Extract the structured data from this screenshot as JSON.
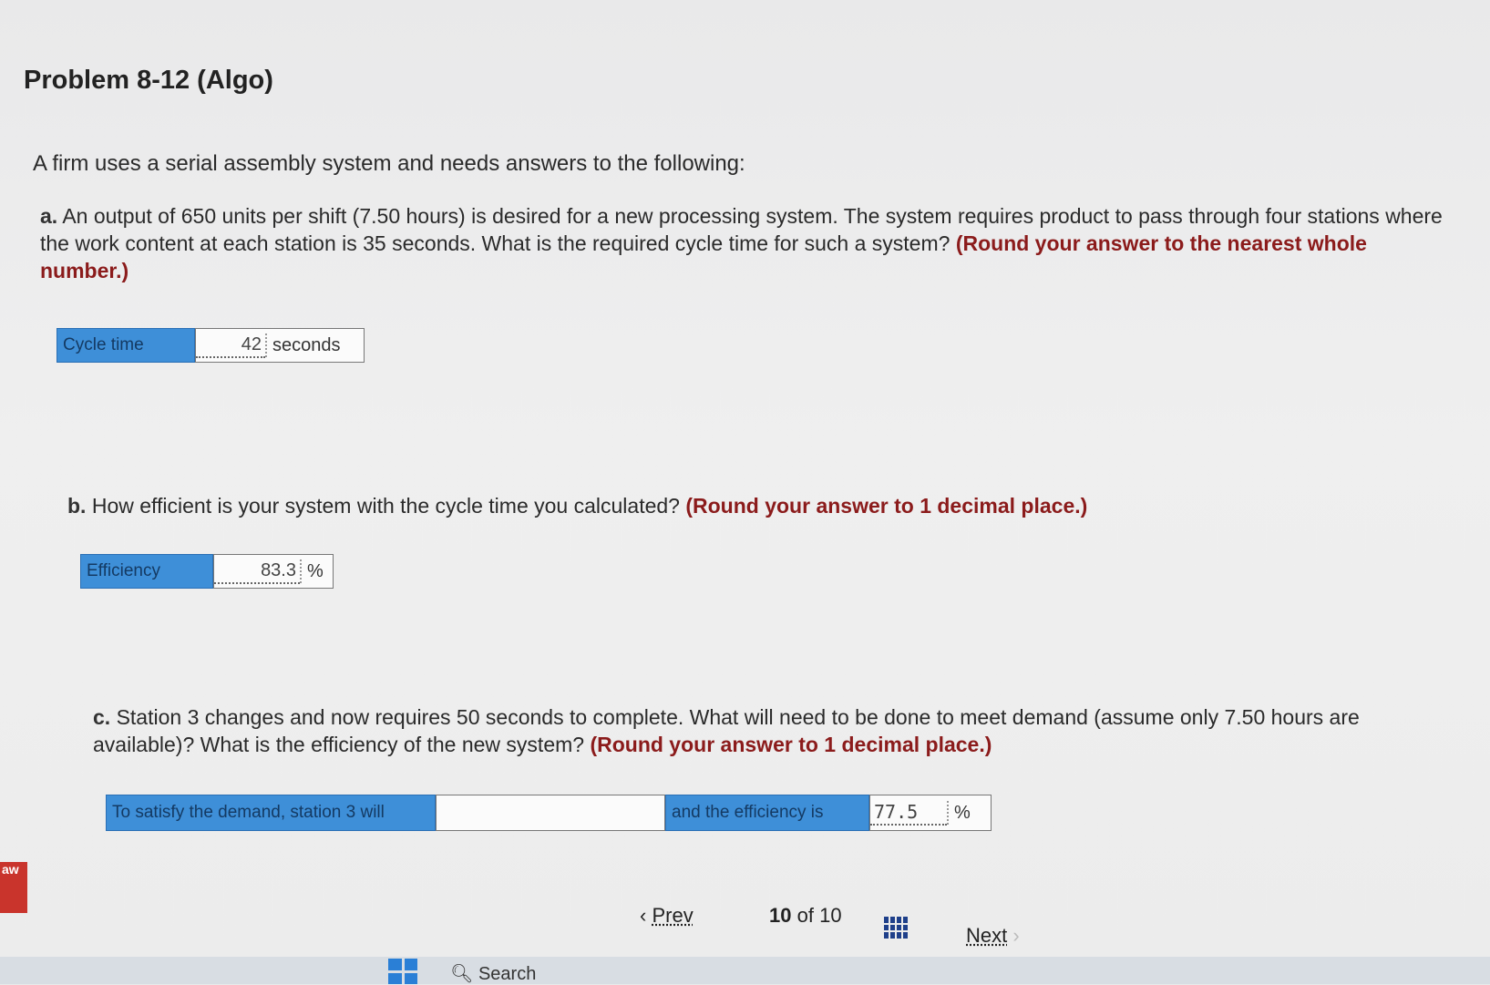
{
  "problem_title": "Problem 8-12 (Algo)",
  "intro": "A firm uses a serial assembly system and needs answers to the following:",
  "part_a": {
    "label": "a.",
    "text": "An output of 650 units per shift (7.50 hours) is desired for a new processing system. The system requires product to pass through four stations where the work content at each station is 35 seconds. What is the required cycle time for such a system?",
    "round_note": "(Round your answer to the nearest whole number.)",
    "field_label": "Cycle time",
    "value": "42",
    "unit": "seconds"
  },
  "part_b": {
    "label": "b.",
    "text": "How efficient is your system with the cycle time you calculated?",
    "round_note": "(Round your answer to 1 decimal place.)",
    "field_label": "Efficiency",
    "value": "83.3",
    "unit": "%"
  },
  "part_c": {
    "label": "c.",
    "text": "Station 3 changes and now requires 50 seconds to complete. What will need to be done to meet demand (assume only 7.50 hours are available)? What is the efficiency of the new system?",
    "round_note": "(Round your answer to 1 decimal place.)",
    "field_label_1": "To satisfy the demand, station 3 will",
    "select_value": "",
    "field_label_2": "and the efficiency is",
    "value": "77.5",
    "unit": "%"
  },
  "nav": {
    "prev": "Prev",
    "current": "10",
    "of_label": "of",
    "total": "10",
    "next": "Next"
  },
  "taskbar": {
    "search": "Search"
  },
  "side_tag": "aw"
}
